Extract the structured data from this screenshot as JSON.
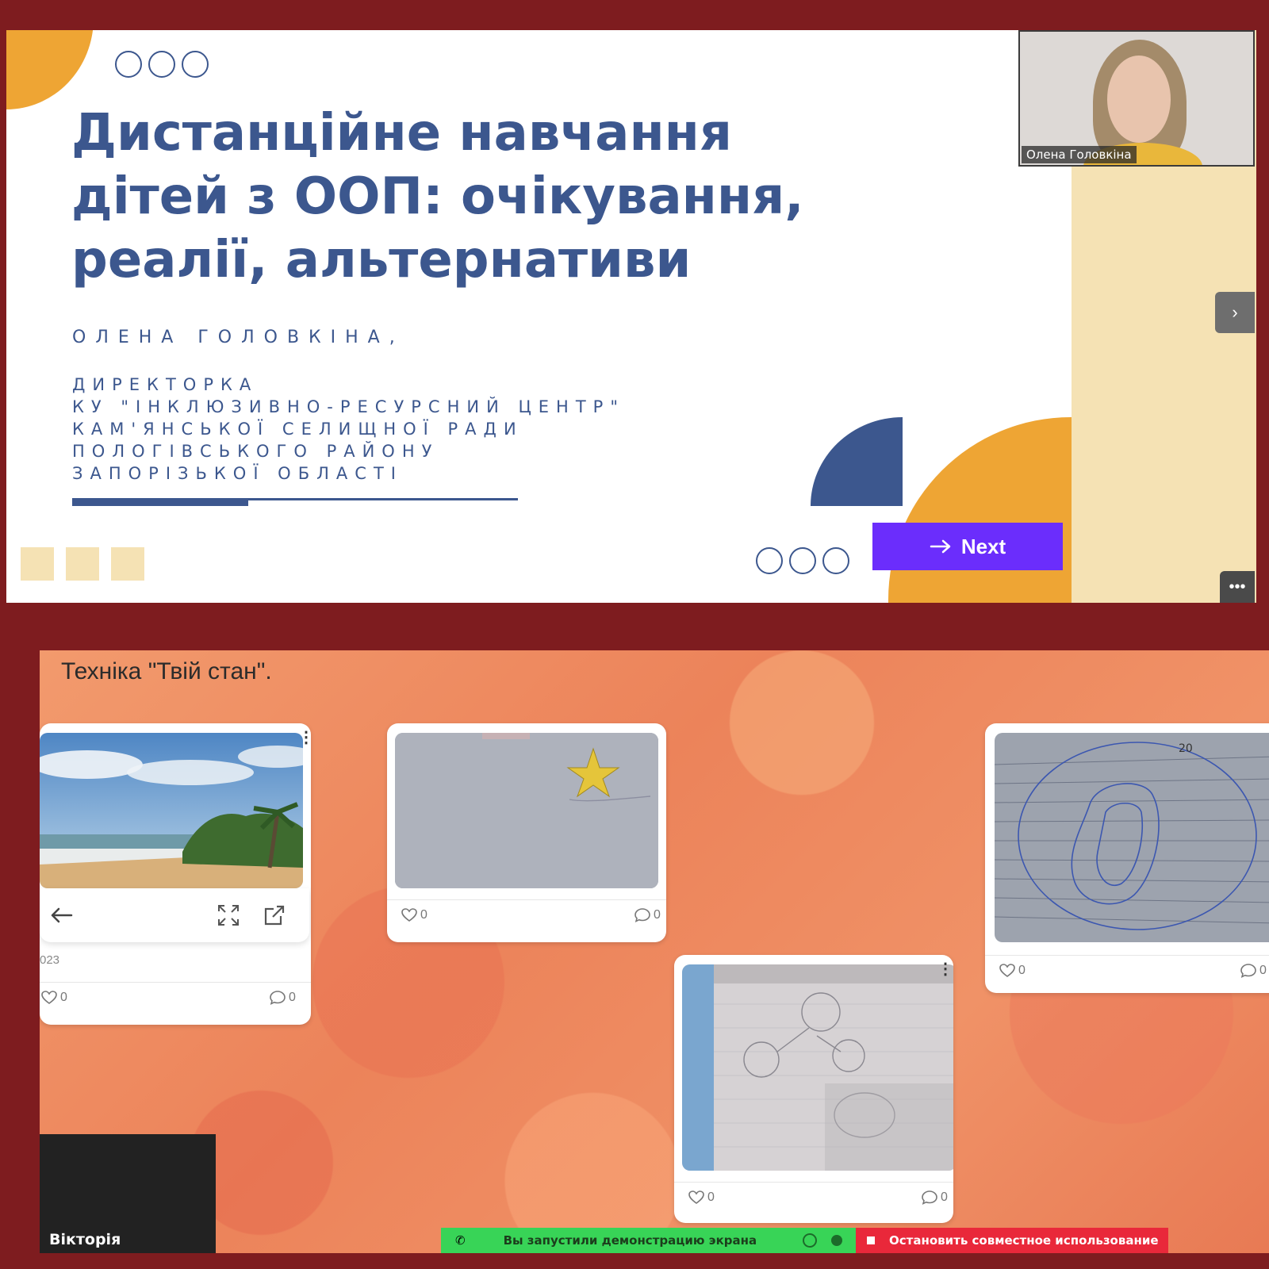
{
  "slide": {
    "title_lines": [
      "Дистанційне навчання",
      "дітей з ООП: очікування,",
      "реалії, альтернативи"
    ],
    "author": "ОЛЕНА ГОЛОВКІНА,",
    "org_lines": [
      "ДИРЕКТОРКА",
      "КУ \"ІНКЛЮЗИВНО-РЕСУРСНИЙ ЦЕНТР\"",
      "КАМ'ЯНСЬКОЇ СЕЛИЩНОЇ РАДИ",
      "ПОЛОГІВСЬКОГО РАЙОНУ",
      "ЗАПОРІЗЬКОЇ ОБЛАСТІ"
    ],
    "next_label": "Next",
    "next_icon": "arrow-right-icon"
  },
  "video": {
    "participant_name": "Олена Головкіна"
  },
  "controls": {
    "side_arrow": "›",
    "more": "•••"
  },
  "board": {
    "heading": "Техніка \"Твій стан\".",
    "cards": [
      {
        "likes": "0",
        "comments": "0",
        "date_fragment": "023"
      },
      {
        "likes": "0",
        "comments": "0"
      },
      {
        "likes": "0",
        "comments": "0"
      },
      {
        "likes": "0",
        "comments": "0"
      }
    ],
    "participant_tile": "Вікторія"
  },
  "share": {
    "status": "Вы запустили демонстрацию экрана",
    "stop": "Остановить совместное использование"
  },
  "colors": {
    "frame": "#7e1c1f",
    "slide_blue": "#3c578e",
    "slide_orange": "#eea534",
    "slide_cream": "#f5e2b4",
    "next_purple": "#6b2dfc",
    "share_green": "#38d457",
    "share_red": "#e9283a"
  }
}
